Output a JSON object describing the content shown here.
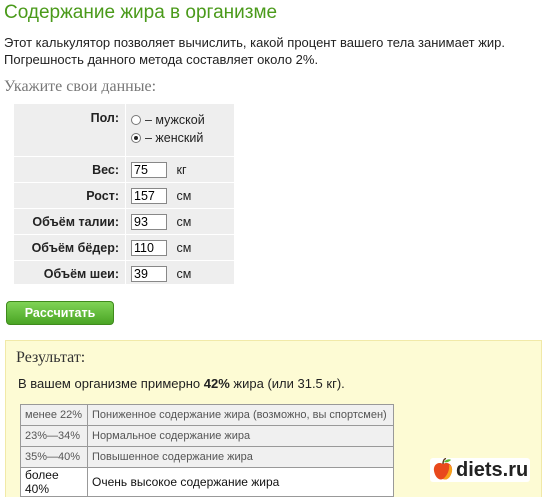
{
  "page": {
    "title": "Содержание жира в организме",
    "description": "Этот калькулятор позволяет вычислить, какой процент вашего тела занимает жир. Погрешность данного метода составляет около 2%.",
    "subtitle": "Укажите свои данные:"
  },
  "form": {
    "sex_label": "Пол:",
    "sex_male": "– мужской",
    "sex_female": "– женский",
    "sex_selected": "female",
    "weight_label": "Вес:",
    "weight_value": "75",
    "weight_unit": "кг",
    "height_label": "Рост:",
    "height_value": "157",
    "height_unit": "см",
    "waist_label": "Объём талии:",
    "waist_value": "93",
    "waist_unit": "см",
    "hips_label": "Объём бёдер:",
    "hips_value": "110",
    "hips_unit": "см",
    "neck_label": "Объём шеи:",
    "neck_value": "39",
    "neck_unit": "см",
    "calculate_label": "Рассчитать"
  },
  "result": {
    "title": "Результат:",
    "text_prefix": "В вашем организме примерно ",
    "percent": "42%",
    "text_suffix": " жира (или 31.5 кг).",
    "rows": [
      {
        "range": "менее 22%",
        "desc": "Пониженное содержание жира (возможно, вы спортсмен)",
        "active": false
      },
      {
        "range": "23%—34%",
        "desc": "Нормальное содержание жира",
        "active": false
      },
      {
        "range": "35%—40%",
        "desc": "Повышенное содержание жира",
        "active": false
      },
      {
        "range": "более 40%",
        "desc": "Очень высокое содержание жира",
        "active": true
      }
    ]
  },
  "logo": {
    "text": "diets.ru",
    "icon": "apple-icon"
  },
  "colors": {
    "title": "#4a9a1a",
    "button": "#5cb833",
    "result_bg": "#fdfbd4",
    "form_bg": "#eeeeee"
  }
}
